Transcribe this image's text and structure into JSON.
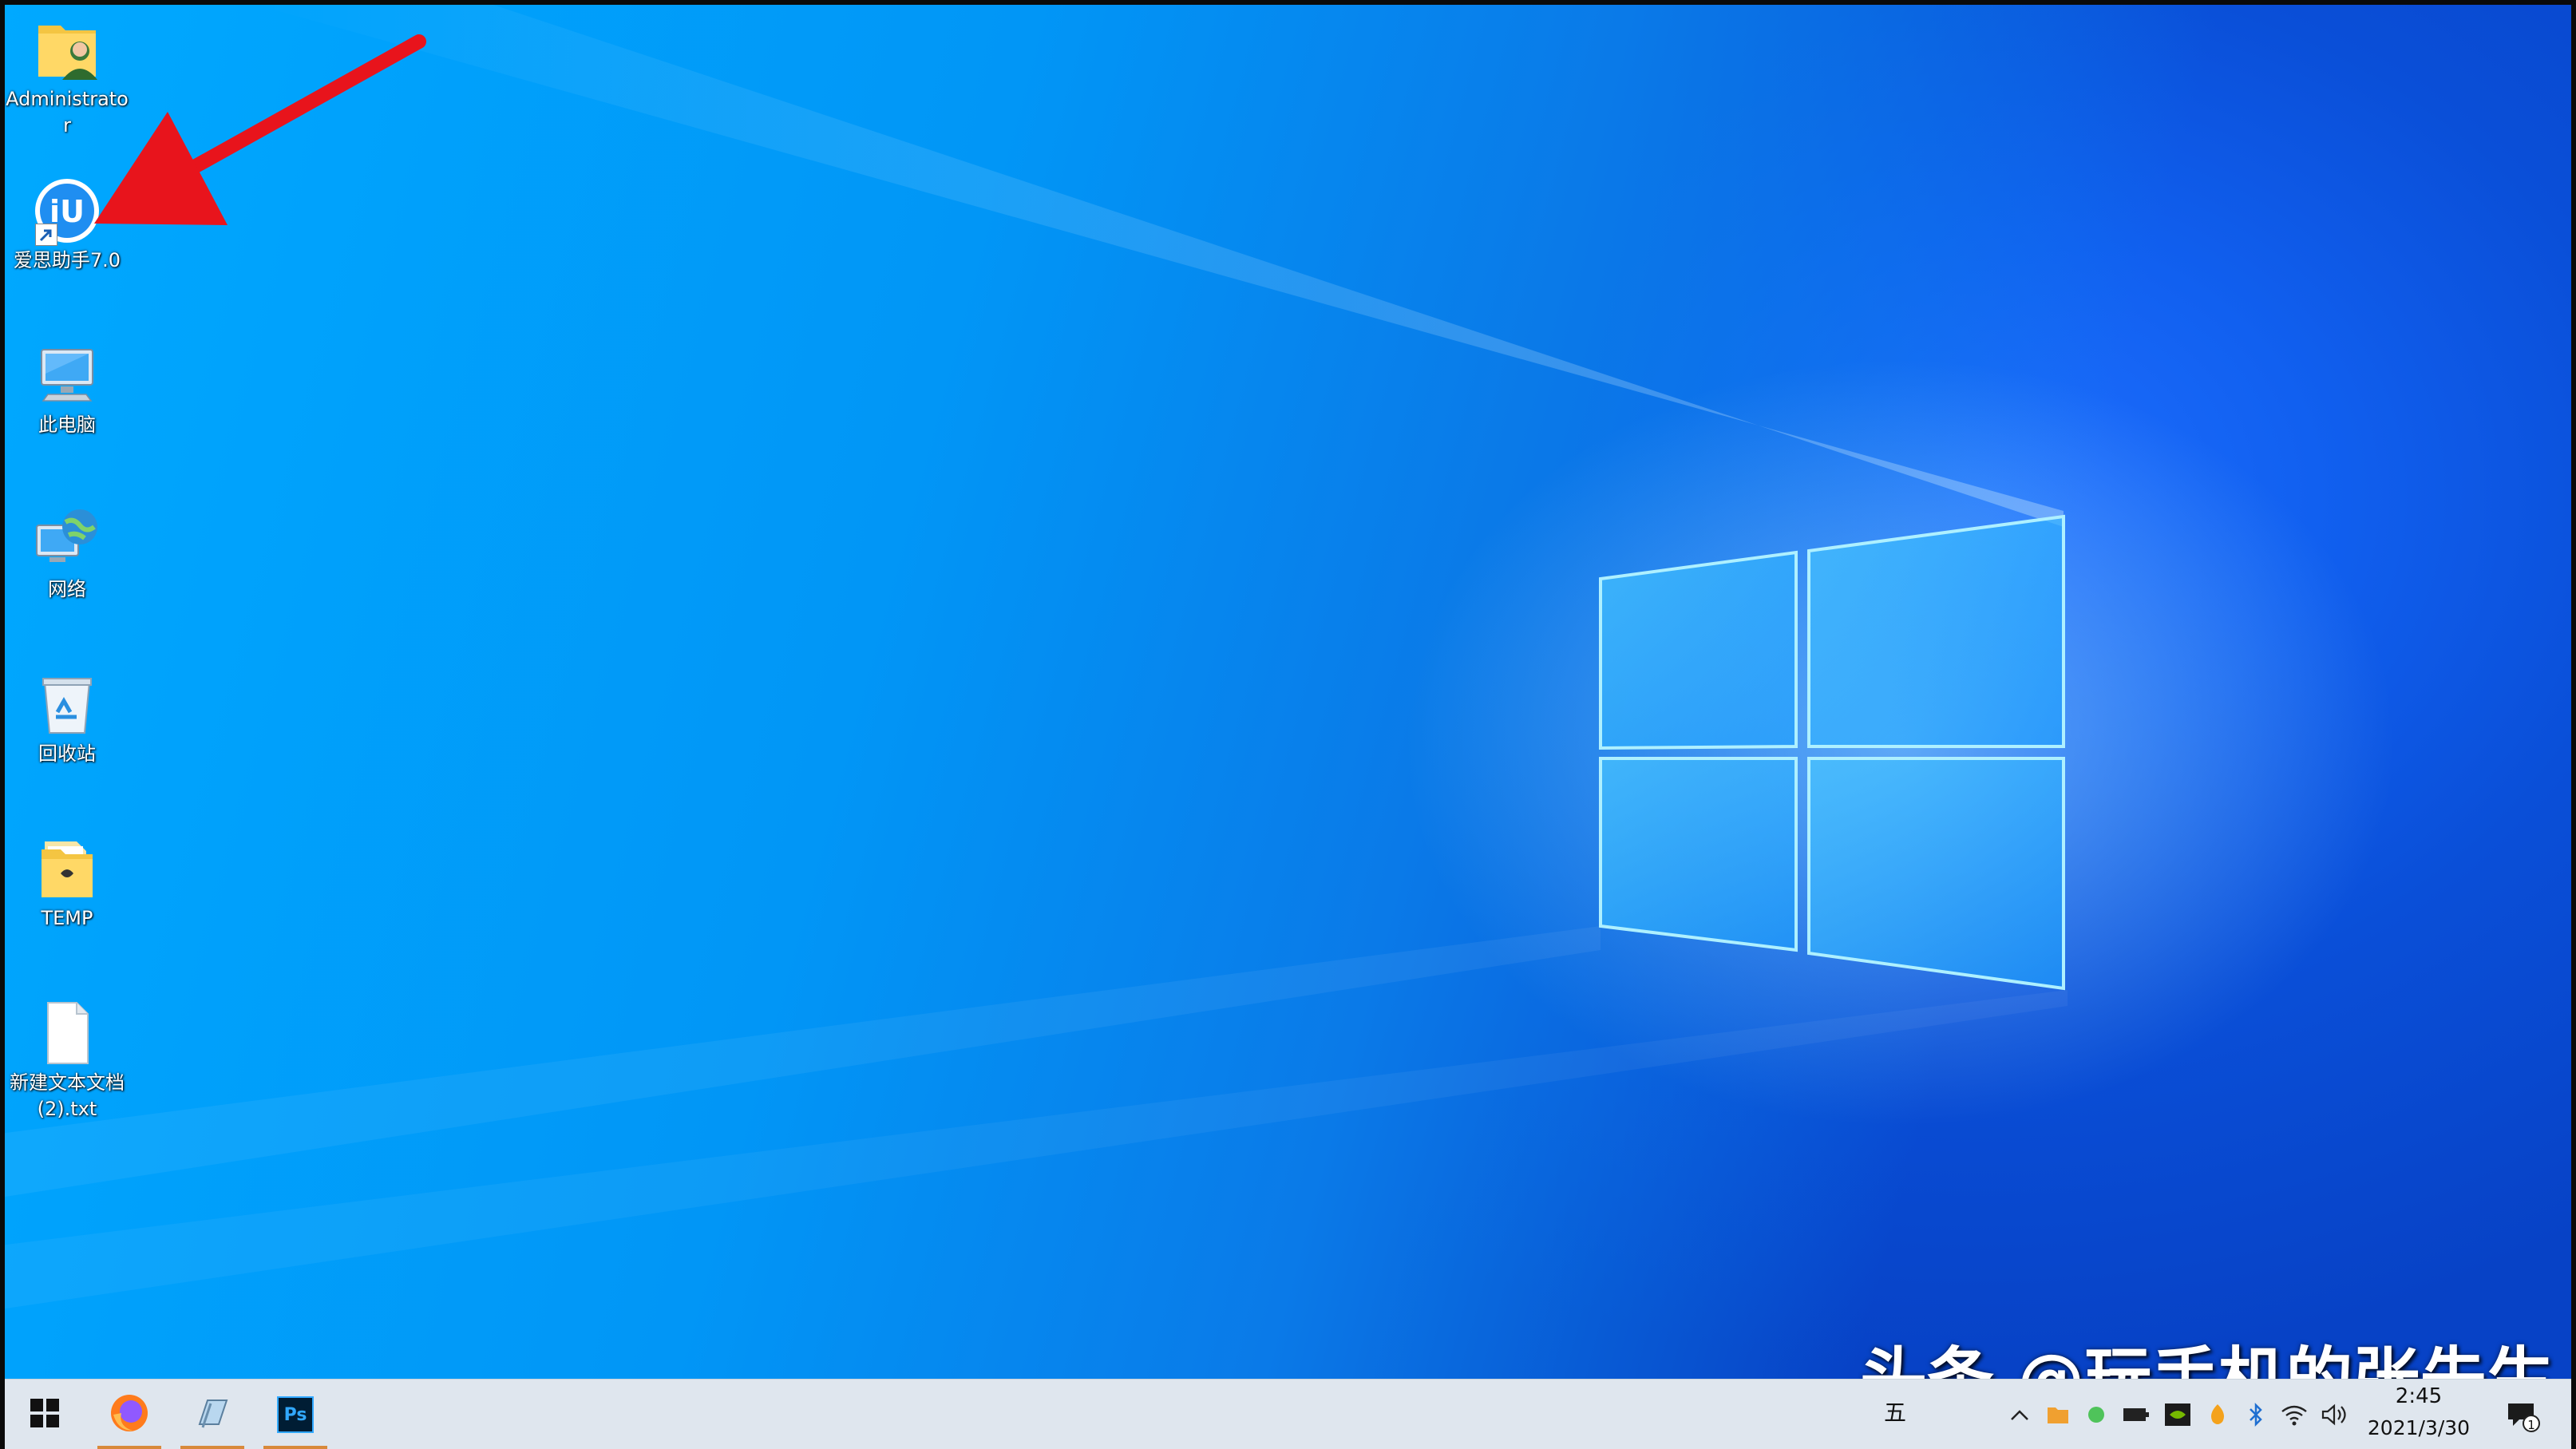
{
  "desktop": {
    "icons": [
      {
        "label": "Administrator",
        "icon": "user-folder-icon"
      },
      {
        "label": "爱思助手7.0",
        "icon": "i4-assistant-icon"
      },
      {
        "label": "此电脑",
        "icon": "computer-icon"
      },
      {
        "label": "网络",
        "icon": "network-icon"
      },
      {
        "label": "回收站",
        "icon": "recycle-bin-icon"
      },
      {
        "label": "TEMP",
        "icon": "folder-icon"
      },
      {
        "label": "新建文本文档 (2).txt",
        "icon": "text-file-icon"
      }
    ]
  },
  "taskbar": {
    "start_icon": "windows-start-icon",
    "pinned": [
      {
        "name": "firefox",
        "icon": "firefox-icon",
        "running": true
      },
      {
        "name": "notepad",
        "icon": "notepad-icon",
        "running": true
      },
      {
        "name": "photoshop",
        "icon": "photoshop-icon",
        "label": "Ps",
        "running": true
      }
    ],
    "ime_label": "五",
    "tray_icons": [
      "chevron-up-icon",
      "folder-tray-icon",
      "green-dot-icon",
      "battery-icon",
      "nvidia-icon",
      "fire-icon",
      "bluetooth-icon",
      "wifi-icon",
      "volume-icon"
    ],
    "clock": {
      "time": "2:45",
      "date": "2021/3/30"
    },
    "notifications": {
      "icon": "notification-icon",
      "count": "1"
    }
  },
  "watermark": "头条 @玩手机的张先生",
  "colors": {
    "annotation_arrow": "#e8141c",
    "taskbar_bg": "#dfe6ee",
    "accent_running": "#d8893b"
  }
}
